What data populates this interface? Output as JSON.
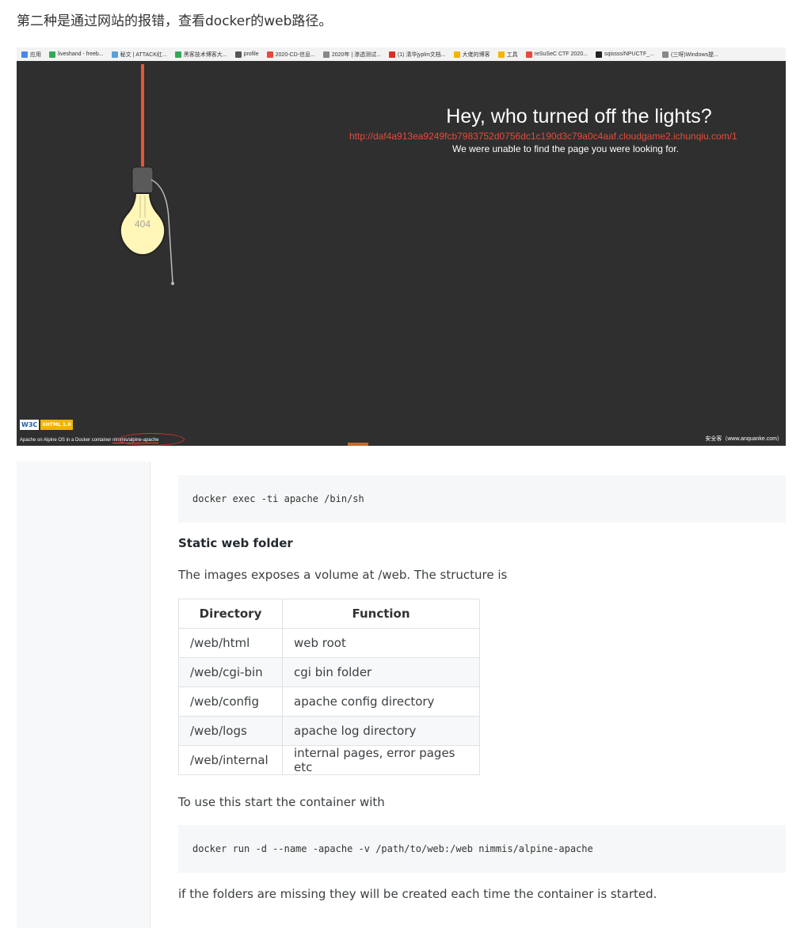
{
  "intro": "第二种是通过网站的报错，查看docker的web路径。",
  "bookmarks": [
    {
      "label": "应用",
      "color": "#4a86e8"
    },
    {
      "label": "liveshand - freeb...",
      "color": "#34a853"
    },
    {
      "label": "秘文 | ATTACK红...",
      "color": "#5aa0d8"
    },
    {
      "label": "黑客技术博客大...",
      "color": "#34a853"
    },
    {
      "label": "profile",
      "color": "#555555"
    },
    {
      "label": "2020-CD-信息...",
      "color": "#e84b3a"
    },
    {
      "label": "2020年 | 渗透测试...",
      "color": "#888888"
    },
    {
      "label": "(1) 清华jyplm文档...",
      "color": "#d93025"
    },
    {
      "label": "大佬的博客",
      "color": "#f4b400"
    },
    {
      "label": "工具",
      "color": "#f4b400"
    },
    {
      "label": "reSuSeC CTF 2020...",
      "color": "#e84b3a"
    },
    {
      "label": "sqissss/NPUCTF_...",
      "color": "#222222"
    },
    {
      "label": "(三呀)Windows提...",
      "color": "#888888"
    }
  ],
  "error_page": {
    "headline": "Hey, who turned off the lights?",
    "url": "http://daf4a913ea9249fcb7983752d0756dc1c190d3c79a0c4aaf.cloudgame2.ichunqiu.com/1",
    "message": "We were unable to find the page you were looking for.",
    "bulb_label": "404",
    "footer_prefix": "Apache on Alpine OS in a Docker container ",
    "footer_link": "nimmis/alpine-apache",
    "watermark": "安全客（www.anquanke.com）",
    "w3c_badge": "W3C",
    "xhtml_badge": "XHTML 1.0"
  },
  "doc": {
    "code1": "docker exec -ti apache /bin/sh",
    "heading": "Static web folder",
    "para1": "The images exposes a volume at /web. The structure is",
    "table": {
      "headers": [
        "Directory",
        "Function"
      ],
      "rows": [
        [
          "/web/html",
          "web root"
        ],
        [
          "/web/cgi-bin",
          "cgi bin folder"
        ],
        [
          "/web/config",
          "apache config directory"
        ],
        [
          "/web/logs",
          "apache log directory"
        ],
        [
          "/web/internal",
          "internal pages, error pages etc"
        ]
      ]
    },
    "para2": "To use this start the container with",
    "code2": "docker run -d --name -apache -v /path/to/web:/web nimmis/alpine-apache",
    "para3": "if the folders are missing they will be created each time the container is started."
  }
}
